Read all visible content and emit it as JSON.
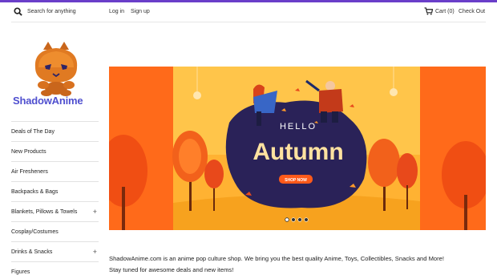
{
  "header": {
    "search_placeholder": "Search for anything",
    "login": "Log in",
    "signup": "Sign up",
    "cart": "Cart (0)",
    "checkout": "Check Out"
  },
  "brand": {
    "name": "ShadowAnime",
    "accent": "#6a3ec9",
    "logo_text_color": "#4f4fcf"
  },
  "sidebar": {
    "items": [
      {
        "label": "Deals of The Day",
        "expandable": false
      },
      {
        "label": "New Products",
        "expandable": false
      },
      {
        "label": "Air Fresheners",
        "expandable": false
      },
      {
        "label": "Backpacks & Bags",
        "expandable": false
      },
      {
        "label": "Blankets, Pillows & Towels",
        "expandable": true,
        "toggle": "+"
      },
      {
        "label": "Cosplay/Costumes",
        "expandable": false
      },
      {
        "label": "Drinks & Snacks",
        "expandable": true,
        "toggle": "+"
      },
      {
        "label": "Figures",
        "expandable": false
      }
    ]
  },
  "banner": {
    "hello": "HELLO",
    "title": "Autumn",
    "cta": "SHOP NOW",
    "slides": 4,
    "active_slide": 1
  },
  "intro": {
    "line1": "ShadowAnime.com is an anime pop culture shop. We bring you the best quality Anime, Toys, Collectibles, Snacks and More!",
    "line2": "Stay tuned for awesome deals and new items!"
  }
}
